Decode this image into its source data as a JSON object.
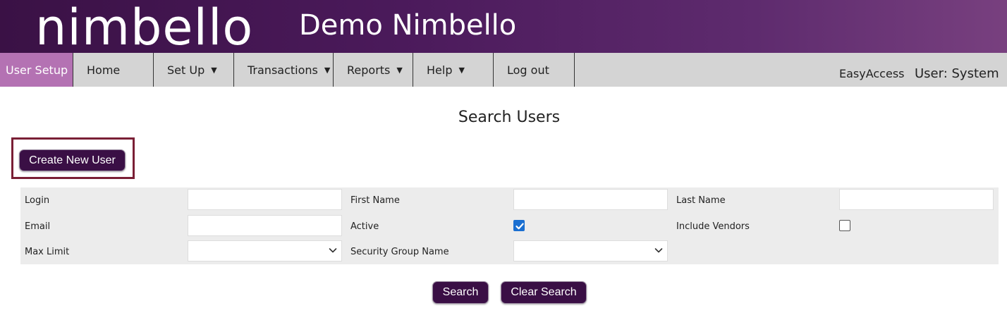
{
  "brand": {
    "logo_text": "nimbello",
    "app_title": "Demo Nimbello"
  },
  "nav": {
    "items": [
      {
        "label": "User Setup",
        "active": true,
        "dropdown": false
      },
      {
        "label": "Home",
        "active": false,
        "dropdown": false
      },
      {
        "label": "Set Up",
        "active": false,
        "dropdown": true
      },
      {
        "label": "Transactions",
        "active": false,
        "dropdown": true
      },
      {
        "label": "Reports",
        "active": false,
        "dropdown": true
      },
      {
        "label": "Help",
        "active": false,
        "dropdown": true
      },
      {
        "label": "Log out",
        "active": false,
        "dropdown": false
      }
    ],
    "right": {
      "easy_access": "EasyAccess",
      "user": "User: System"
    },
    "caret_glyph": "▼"
  },
  "page": {
    "title": "Search Users",
    "create_button": "Create New User"
  },
  "form": {
    "login": {
      "label": "Login",
      "value": ""
    },
    "first_name": {
      "label": "First Name",
      "value": ""
    },
    "last_name": {
      "label": "Last Name",
      "value": ""
    },
    "email": {
      "label": "Email",
      "value": ""
    },
    "active": {
      "label": "Active",
      "checked": true
    },
    "include_vendors": {
      "label": "Include Vendors",
      "checked": false
    },
    "max_limit": {
      "label": "Max Limit",
      "value": ""
    },
    "security_group": {
      "label": "Security Group Name",
      "value": ""
    }
  },
  "actions": {
    "search": "Search",
    "clear_search": "Clear Search"
  },
  "colors": {
    "header_dark": "#3a1145",
    "header_light": "#78407f",
    "nav_active": "#b472b3",
    "nav_bg": "#d4d4d4",
    "button_bg": "#3a0f45",
    "highlight_border": "#7a1f35",
    "checkbox_checked": "#1a6fd1",
    "form_bg": "#ececec"
  },
  "icons": {
    "caret": "caret-down-icon",
    "select_chevron": "chevron-down-icon",
    "checkbox_checked": "checkmark-icon"
  }
}
